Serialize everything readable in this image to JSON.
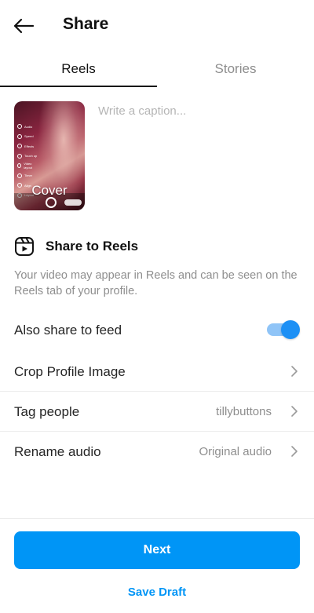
{
  "header": {
    "title": "Share",
    "back_icon": "arrow-left-icon"
  },
  "tabs": [
    {
      "label": "Reels",
      "active": true
    },
    {
      "label": "Stories",
      "active": false
    }
  ],
  "thumbnail": {
    "cover_label": "Cover",
    "tools": [
      "Audio",
      "Speed",
      "Effects",
      "Touch up",
      "Video layout",
      "Timer",
      "Align",
      "Layout"
    ]
  },
  "caption": {
    "placeholder": "Write a caption...",
    "value": ""
  },
  "share_to_reels": {
    "icon": "reels-icon",
    "label": "Share to Reels",
    "description": "Your video may appear in Reels and can be seen on the Reels tab of your profile."
  },
  "also_share_to_feed": {
    "label": "Also share to feed",
    "enabled": true
  },
  "rows": [
    {
      "label": "Crop Profile Image",
      "value": ""
    },
    {
      "label": "Tag people",
      "value": "tillybuttons"
    },
    {
      "label": "Rename audio",
      "value": "Original audio"
    }
  ],
  "actions": {
    "next_label": "Next",
    "save_draft_label": "Save Draft"
  },
  "colors": {
    "accent": "#0095f6",
    "toggle_knob": "#1d90f5",
    "toggle_track": "#8fc4f7",
    "muted_text": "#8e8e8e"
  }
}
